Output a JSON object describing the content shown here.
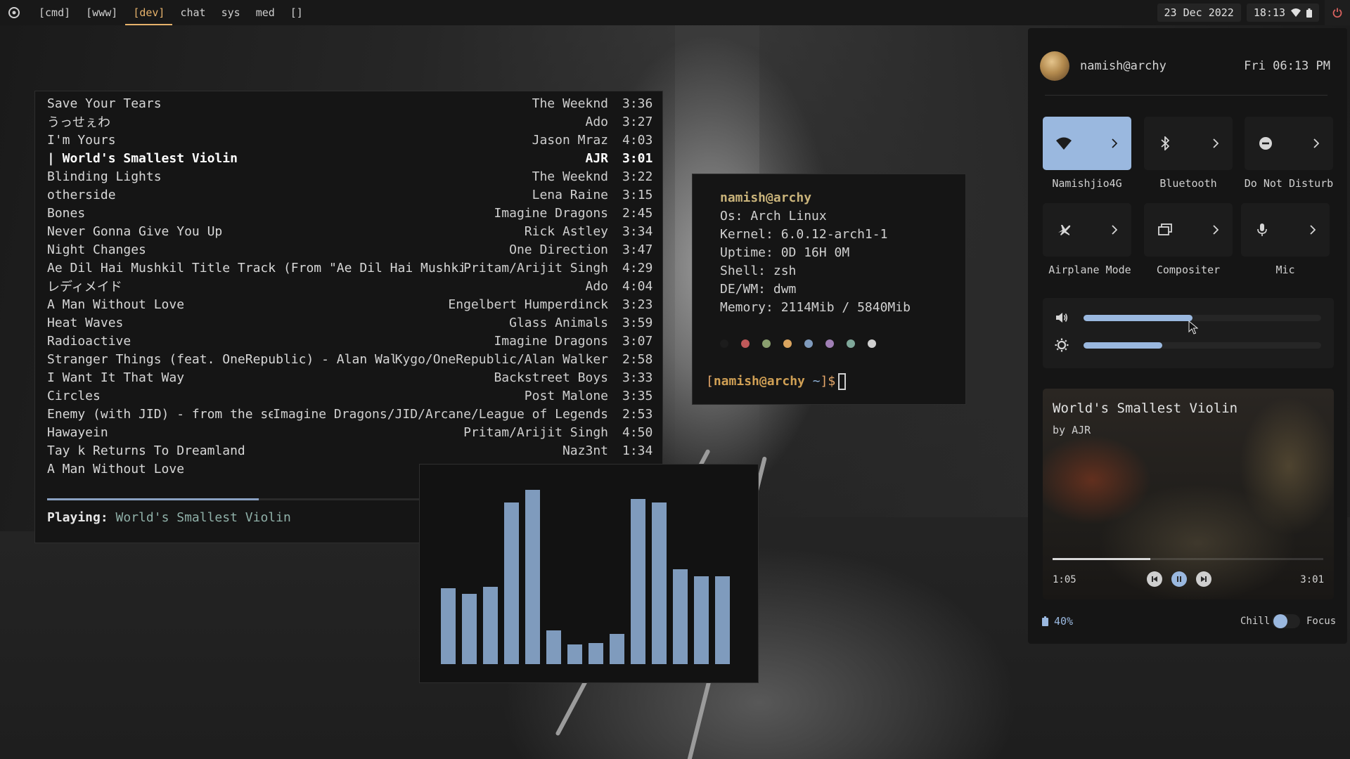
{
  "topbar": {
    "tags": [
      "[cmd]",
      "[www]",
      "[dev]",
      "chat",
      "sys",
      "med",
      "[]"
    ],
    "active_tag": 2,
    "date": "23 Dec 2022",
    "time": "18:13"
  },
  "music": {
    "songs": [
      {
        "title": "Save Your Tears",
        "artist": "The Weeknd",
        "duration": "3:36"
      },
      {
        "title": "うっせぇわ",
        "artist": "Ado",
        "duration": "3:27"
      },
      {
        "title": "I'm Yours",
        "artist": "Jason Mraz",
        "duration": "4:03"
      },
      {
        "title": "| World's Smallest Violin",
        "artist": "AJR",
        "duration": "3:01"
      },
      {
        "title": "Blinding Lights",
        "artist": "The Weeknd",
        "duration": "3:22"
      },
      {
        "title": "otherside",
        "artist": "Lena Raine",
        "duration": "3:15"
      },
      {
        "title": "Bones",
        "artist": "Imagine Dragons",
        "duration": "2:45"
      },
      {
        "title": "Never Gonna Give You Up",
        "artist": "Rick Astley",
        "duration": "3:34"
      },
      {
        "title": "Night Changes",
        "artist": "One Direction",
        "duration": "3:47"
      },
      {
        "title": "Ae Dil Hai Mushkil Title Track (From \"Ae Dil Hai Mushkil\")",
        "artist": "Pritam/Arijit Singh",
        "duration": "4:29"
      },
      {
        "title": "レディメイド",
        "artist": "Ado",
        "duration": "4:04"
      },
      {
        "title": "A Man Without Love",
        "artist": "Engelbert Humperdinck",
        "duration": "3:23"
      },
      {
        "title": "Heat Waves",
        "artist": "Glass Animals",
        "duration": "3:59"
      },
      {
        "title": "Radioactive",
        "artist": "Imagine Dragons",
        "duration": "3:07"
      },
      {
        "title": "Stranger Things (feat. OneRepublic) - Alan Walker",
        "artist": "Kygo/OneRepublic/Alan Walker",
        "duration": "2:58"
      },
      {
        "title": "I Want It That Way",
        "artist": "Backstreet Boys",
        "duration": "3:33"
      },
      {
        "title": "Circles",
        "artist": "Post Malone",
        "duration": "3:35"
      },
      {
        "title": "Enemy (with JID) - from the series",
        "artist": "Imagine Dragons/JID/Arcane/League of Legends",
        "duration": "2:53"
      },
      {
        "title": "Hawayein",
        "artist": "Pritam/Arijit Singh",
        "duration": "4:50"
      },
      {
        "title": "Tay k Returns To Dreamland",
        "artist": "Naz3nt",
        "duration": "1:34"
      },
      {
        "title": "A Man Without Love",
        "artist": "",
        "duration": ""
      }
    ],
    "current_index": 3,
    "progress": 0.35,
    "playing_label": "Playing:",
    "playing_value": "World's Smallest Violin"
  },
  "terminal": {
    "user_host": "namish@archy",
    "lines": [
      "Os: Arch Linux",
      "Kernel: 6.0.12-arch1-1",
      "Uptime: 0D 16H 0M",
      "Shell: zsh",
      "DE/WM: dwm",
      "Memory: 2114Mib / 5840Mib"
    ],
    "palette": [
      "#1c1c1c",
      "#c0595a",
      "#8a9f6f",
      "#d9a45f",
      "#7f9bbd",
      "#a07fb5",
      "#7fa89a",
      "#d0d0d0"
    ],
    "prompt_open": "[",
    "prompt_user": "namish@archy",
    "prompt_dir": " ~",
    "prompt_close": "]$"
  },
  "visualizer": {
    "levels": [
      0.43,
      0.4,
      0.44,
      0.92,
      0.99,
      0.19,
      0.11,
      0.12,
      0.17,
      0.94,
      0.92,
      0.54,
      0.5,
      0.5
    ]
  },
  "control_center": {
    "user": "namish@archy",
    "datetime": "Fri 06:13 PM",
    "tiles": [
      {
        "label": "Namishjio4G",
        "icon": "wifi-icon",
        "active": true
      },
      {
        "label": "Bluetooth",
        "icon": "bluetooth-icon",
        "active": false
      },
      {
        "label": "Do Not Disturb",
        "icon": "dnd-icon",
        "active": false
      },
      {
        "label": "Airplane Mode",
        "icon": "airplane-icon",
        "active": false
      },
      {
        "label": "Compositer",
        "icon": "compositor-icon",
        "active": false
      },
      {
        "label": "Mic",
        "icon": "mic-icon",
        "active": false
      }
    ],
    "volume": 0.46,
    "brightness": 0.33,
    "media": {
      "title": "World's Smallest Violin",
      "artist": "by AJR",
      "elapsed": "1:05",
      "total": "3:01",
      "progress": 0.36
    },
    "battery": "40%",
    "mode_left": "Chill",
    "mode_right": "Focus",
    "accent": "#9ab8df"
  }
}
